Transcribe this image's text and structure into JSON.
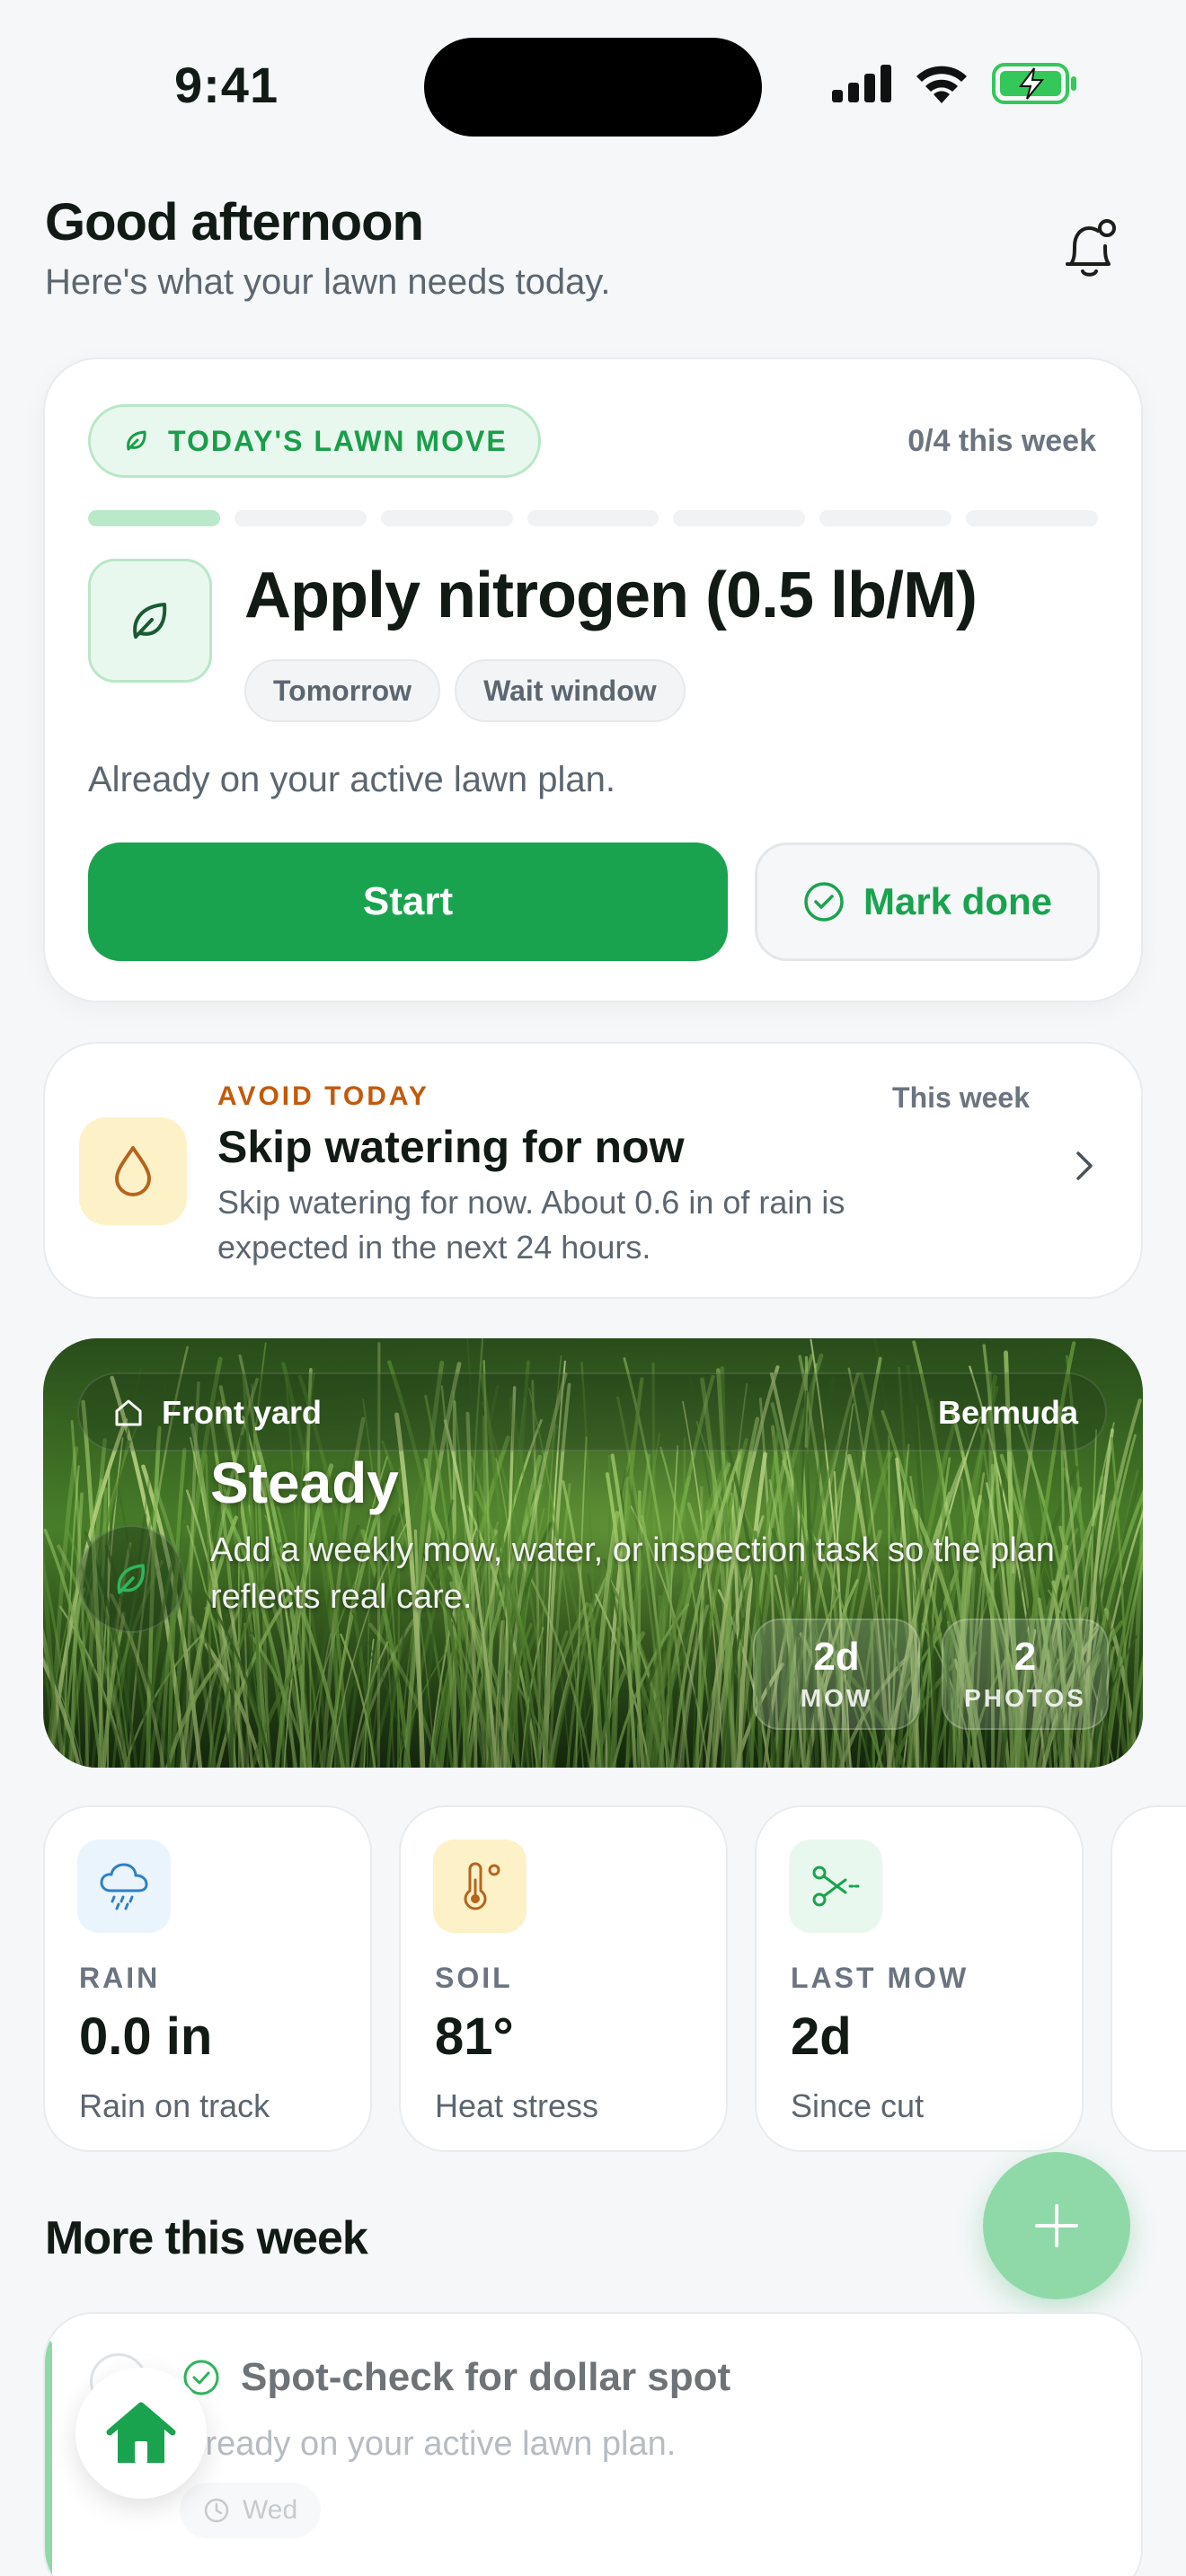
{
  "status_bar": {
    "time": "9:41"
  },
  "header": {
    "greeting": "Good afternoon",
    "subtitle": "Here's what your lawn needs today."
  },
  "todays_move": {
    "pill_label": "TODAY'S LAWN MOVE",
    "week_progress": "0/4 this week",
    "progress_segments_total": 7,
    "progress_segments_filled": 1,
    "task_title": "Apply nitrogen (0.5 lb/M)",
    "chips": [
      "Tomorrow",
      "Wait window"
    ],
    "note": "Already on your active lawn plan.",
    "start_label": "Start",
    "done_label": "Mark done"
  },
  "avoid": {
    "kicker": "AVOID TODAY",
    "when": "This week",
    "title": "Skip watering for now",
    "description": "Skip watering for now. About 0.6 in of rain is expected in the next 24 hours."
  },
  "lawn": {
    "yard_name": "Front yard",
    "grass_type": "Bermuda",
    "status": "Steady",
    "description": "Add a weekly mow, water, or inspection task so the plan reflects real care.",
    "stats": [
      {
        "value": "2d",
        "label": "MOW"
      },
      {
        "value": "2",
        "label": "PHOTOS"
      }
    ]
  },
  "metrics": [
    {
      "icon": "rain-cloud-icon",
      "label": "RAIN",
      "value": "0.0 in",
      "sub": "Rain on track",
      "icon_bg": "#eaf4fd"
    },
    {
      "icon": "thermometer-icon",
      "label": "SOIL",
      "value": "81°",
      "sub": "Heat stress",
      "icon_bg": "#fdf1c8"
    },
    {
      "icon": "scissors-icon",
      "label": "LAST MOW",
      "value": "2d",
      "sub": "Since cut",
      "icon_bg": "#e9f8ee"
    }
  ],
  "more_this_week": {
    "title": "More this week",
    "task_title": "Spot-check for dollar spot",
    "task_note": "lready on your active lawn plan.",
    "task_day": "Wed"
  },
  "colors": {
    "accent_green": "#1aa34f",
    "warning_orange": "#c25a0c",
    "fab_green": "#8fd9a8"
  }
}
